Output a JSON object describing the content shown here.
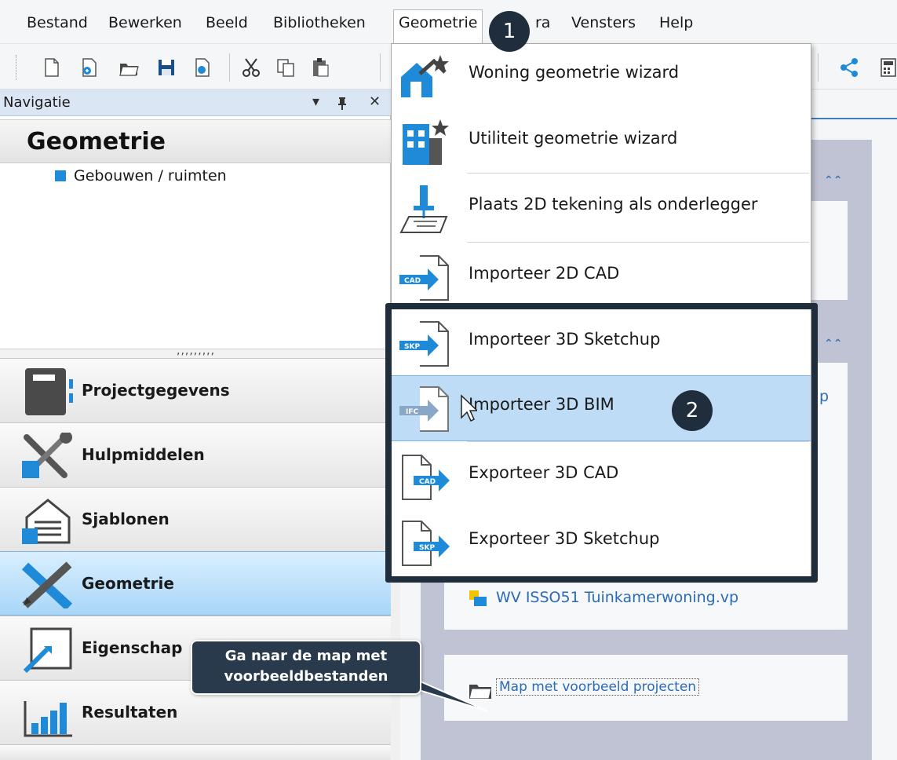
{
  "menubar": {
    "items": [
      "Bestand",
      "Bewerken",
      "Beeld",
      "Bibliotheken",
      "Geometrie",
      "Extra",
      "Vensters",
      "Help"
    ],
    "extra_visible": "ra"
  },
  "navigation": {
    "title": "Navigatie",
    "pin_glyph": "▾",
    "close_glyph": "✕",
    "header": "Geometrie",
    "tree_items": [
      "Gebouwen / ruimten"
    ],
    "splitter_dots": ",,,,,,,,,",
    "sections": [
      "Projectgegevens",
      "Hulpmiddelen",
      "Sjablonen",
      "Geometrie",
      "Eigenschappen",
      "Resultaten"
    ],
    "eigenschappen_visible": "Eigenschap",
    "active_section": "Geometrie"
  },
  "dropdown": {
    "items": [
      {
        "label": "Woning geometrie wizard",
        "icon": "house-star-icon"
      },
      {
        "label": "Utiliteit geometrie wizard",
        "icon": "building-star-icon"
      },
      {
        "label": "Plaats 2D tekening als onderlegger",
        "icon": "place-drawing-icon"
      },
      {
        "label": "Importeer 2D CAD",
        "icon": "import-cad-icon",
        "badge": "CAD"
      },
      {
        "label": "Importeer 3D Sketchup",
        "icon": "import-skp-icon",
        "badge": "SKP"
      },
      {
        "label": "Importeer 3D BIM",
        "icon": "import-ifc-icon",
        "badge": "IFC"
      },
      {
        "label": "Exporteer 3D CAD",
        "icon": "export-cad-icon",
        "badge": "CAD"
      },
      {
        "label": "Exporteer 3D Sketchup",
        "icon": "export-skp-icon",
        "badge": "SKP"
      }
    ],
    "hovered": "Importeer 3D BIM"
  },
  "content": {
    "partial_link": "p",
    "recent_file": "WV ISSO51 Tuinkamerwoning.vp",
    "folder_link": "Map met voorbeeld projecten"
  },
  "callout": {
    "line1": "Ga naar de map met",
    "line2": "voorbeeldbestanden"
  },
  "markers": [
    "1",
    "2"
  ],
  "colors": {
    "accent": "#1f8bd8",
    "highlight_frame": "#1f2d3d",
    "hover": "#bedcf5",
    "link": "#2a6ab7"
  }
}
